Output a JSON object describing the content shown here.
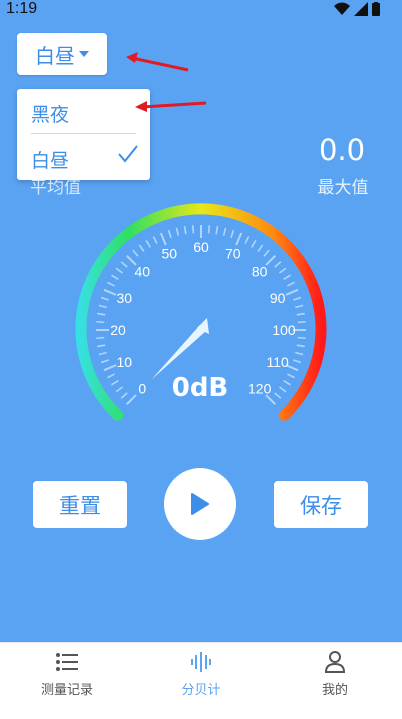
{
  "status_bar": {
    "time": "1:19"
  },
  "mode_selector": {
    "label": "白昼",
    "options": [
      "黑夜",
      "白昼"
    ],
    "selected": "白昼"
  },
  "stats": {
    "average_label": "平均值",
    "max_value": "0.0",
    "max_label": "最大值"
  },
  "gauge": {
    "reading": "0dB",
    "value": 0,
    "min": 0,
    "max": 120,
    "ticks": [
      "0",
      "10",
      "20",
      "30",
      "40",
      "50",
      "60",
      "70",
      "80",
      "90",
      "100",
      "110",
      "120"
    ]
  },
  "controls": {
    "reset_label": "重置",
    "save_label": "保存",
    "play_icon": "play-icon"
  },
  "tabbar": {
    "tabs": [
      {
        "label": "测量记录",
        "icon": "list-icon"
      },
      {
        "label": "分贝计",
        "icon": "soundwave-icon"
      },
      {
        "label": "我的",
        "icon": "user-icon"
      }
    ],
    "active": "分贝计"
  },
  "colors": {
    "background": "#5aa3f2",
    "accent": "#3d8ee8",
    "annotation_arrow": "#e01b24"
  }
}
